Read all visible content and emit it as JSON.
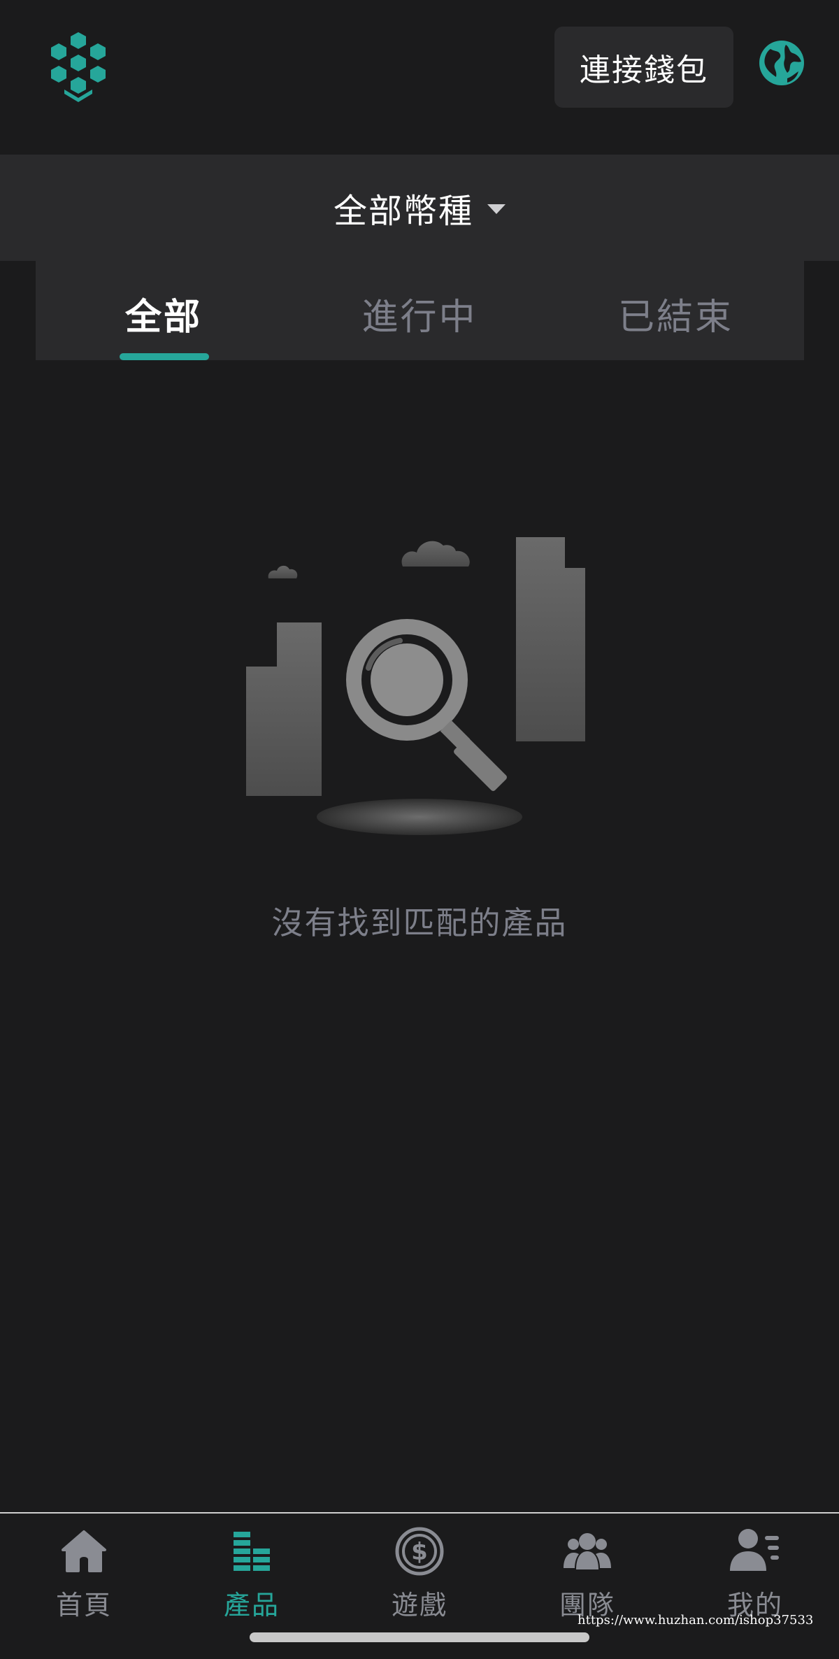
{
  "header": {
    "connect_wallet_label": "連接錢包"
  },
  "filter": {
    "currency_label": "全部幣種"
  },
  "tabs": [
    {
      "label": "全部",
      "active": true
    },
    {
      "label": "進行中",
      "active": false
    },
    {
      "label": "已結束",
      "active": false
    }
  ],
  "empty_state": {
    "message": "沒有找到匹配的產品"
  },
  "bottom_nav": [
    {
      "label": "首頁",
      "icon": "home-icon",
      "active": false
    },
    {
      "label": "產品",
      "icon": "products-icon",
      "active": true
    },
    {
      "label": "遊戲",
      "icon": "dollar-coin-icon",
      "active": false
    },
    {
      "label": "團隊",
      "icon": "team-icon",
      "active": false
    },
    {
      "label": "我的",
      "icon": "profile-icon",
      "active": false
    }
  ],
  "watermark": "https://www.huzhan.com/ishop37533",
  "colors": {
    "accent": "#26a69a",
    "background": "#1b1b1c",
    "panel": "#2a2a2c",
    "muted_text": "#7d7f8a",
    "inactive_icon": "#8a8c93"
  }
}
